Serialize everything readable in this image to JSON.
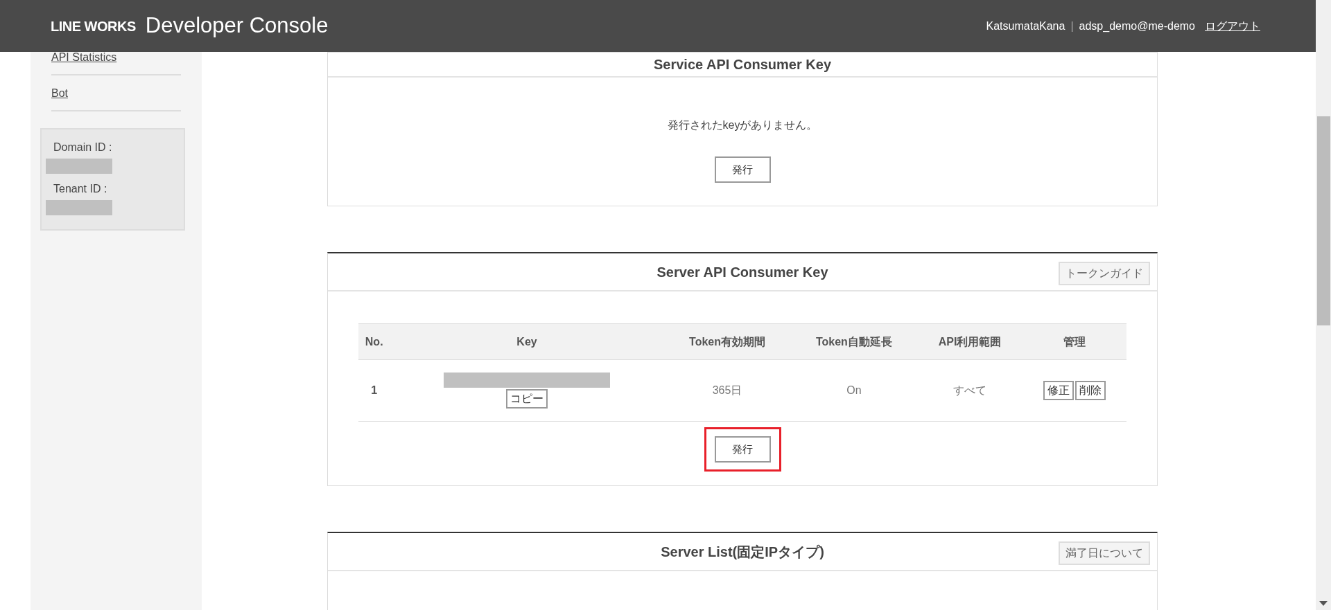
{
  "header": {
    "logo": "LINE WORKS",
    "title": "Developer Console",
    "user": "KatsumataKana",
    "separator": "|",
    "account": "adsp_demo@me-demo",
    "logout": "ログアウト"
  },
  "sidebar": {
    "items": [
      "API Statistics",
      "Bot"
    ],
    "info": [
      {
        "label": "Domain ID :"
      },
      {
        "label": "Tenant ID :"
      }
    ]
  },
  "sections": [
    {
      "title": "Service API Consumer Key",
      "message": "発行されたkeyがありません。",
      "issue_button": "発行",
      "highlighted": false
    },
    {
      "title": "Server API Consumer Key",
      "guide_button": "トークンガイド",
      "table": {
        "columns": [
          "No.",
          "Key",
          "Token有効期間",
          "Token自動延長",
          "API利用範囲",
          "管理"
        ],
        "rows": [
          {
            "no": "1",
            "copy": "コピー",
            "expiry": "365日",
            "auto_extend": "On",
            "scope": "すべて",
            "actions": [
              "修正",
              "削除"
            ]
          }
        ]
      },
      "issue_button": "発行",
      "highlighted": true
    },
    {
      "title": "Server List(固定IPタイプ)",
      "guide_button": "満了日について"
    }
  ]
}
